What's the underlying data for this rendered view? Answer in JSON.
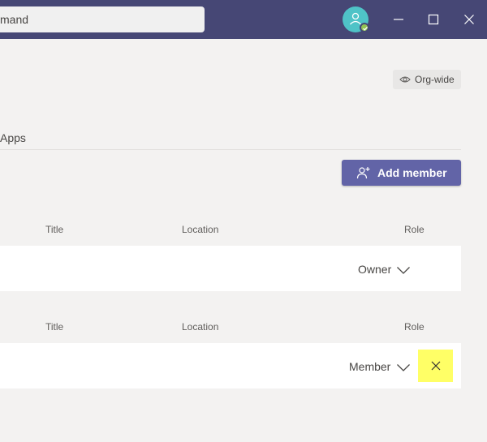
{
  "titlebar": {
    "search": {
      "value": "mand"
    },
    "avatar_icon": "user-avatar-icon",
    "presence": "available",
    "buttons": [
      "minimize-icon",
      "maximize-icon",
      "close-icon"
    ],
    "bg_color": "#464775"
  },
  "header": {
    "privacy_badge": {
      "label": "Org-wide",
      "icon": "eye-icon"
    }
  },
  "tabs": {
    "apps_label": "Apps"
  },
  "toolbar": {
    "add_member_label": "Add member",
    "accent": "#6264a7"
  },
  "owners_section": {
    "columns": {
      "title": "Title",
      "location": "Location",
      "role": "Role"
    },
    "rows": [
      {
        "role": "Owner"
      }
    ]
  },
  "members_section": {
    "columns": {
      "title": "Title",
      "location": "Location",
      "role": "Role"
    },
    "rows": [
      {
        "role": "Member"
      }
    ]
  }
}
